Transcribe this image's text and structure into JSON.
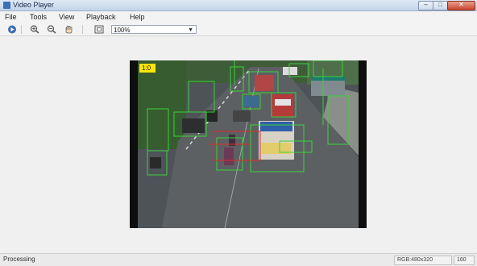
{
  "window": {
    "title": "Video Player"
  },
  "menu": {
    "items": [
      "File",
      "Tools",
      "View",
      "Playback",
      "Help"
    ]
  },
  "toolbar": {
    "buttons": [
      "play-icon",
      "zoom-in-icon",
      "zoom-out-icon",
      "pan-icon",
      "fit-to-window-icon"
    ],
    "zoom_value": "100%"
  },
  "video": {
    "frame_label": "1:0"
  },
  "status": {
    "text": "Processing",
    "format": "RGB:480x320",
    "frame": "160"
  },
  "colors": {
    "detection_box": "#3bd23b",
    "tracking_box": "#e02a2a",
    "label_bg": "#ffe600"
  }
}
